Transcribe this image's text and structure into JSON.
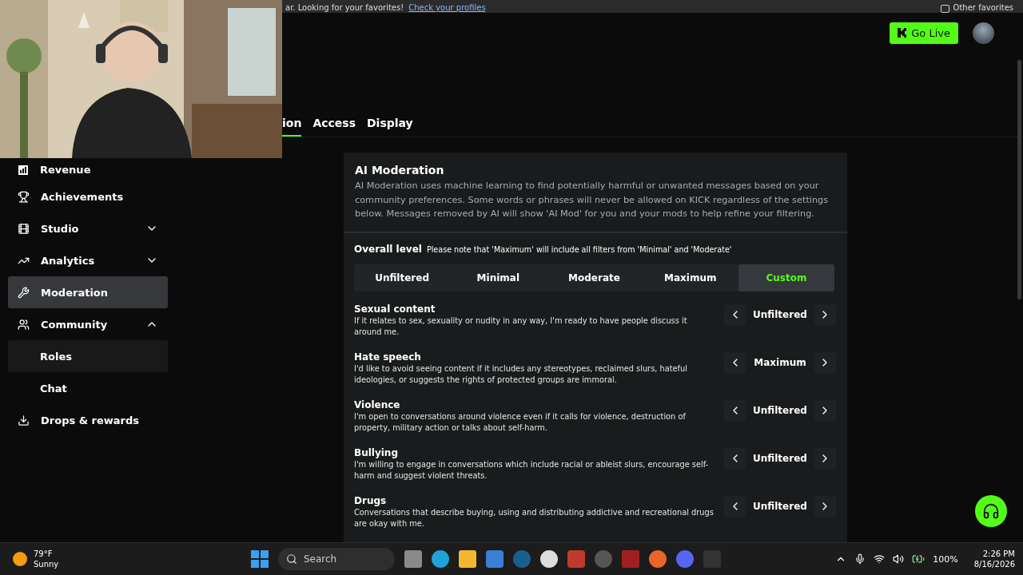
{
  "browser_bar": {
    "message": "ar. Looking for your favorites!",
    "link": "Check your profiles",
    "favorites": "Other favorites"
  },
  "header": {
    "go_live": "Go Live"
  },
  "tabs": [
    {
      "label": "ion",
      "selected": true
    },
    {
      "label": "Access",
      "selected": false
    },
    {
      "label": "Display",
      "selected": false
    }
  ],
  "sidebar": {
    "items": [
      {
        "label": "Revenue",
        "selected": false,
        "hovered": false
      },
      {
        "label": "Achievements",
        "selected": false,
        "hovered": false
      },
      {
        "label": "Studio",
        "selected": false,
        "hovered": false,
        "expanded": false
      },
      {
        "label": "Analytics",
        "selected": false,
        "hovered": false,
        "expanded": false
      },
      {
        "label": "Moderation",
        "selected": true,
        "hovered": false
      },
      {
        "label": "Community",
        "selected": false,
        "hovered": false,
        "expanded": true,
        "children": [
          {
            "label": "Roles",
            "selected": false,
            "hovered": true
          },
          {
            "label": "Chat",
            "selected": false,
            "hovered": false
          }
        ]
      },
      {
        "label": "Drops & rewards",
        "selected": false,
        "hovered": false
      }
    ]
  },
  "card": {
    "title": "AI Moderation",
    "description": "AI Moderation uses machine learning to find potentially harmful or unwanted messages based on your community preferences. Some words or phrases will never be allowed on KICK regardless of the settings below. Messages removed by AI will show 'AI Mod' for you and your mods to help refine your filtering.",
    "overall_label": "Overall level",
    "overall_note": "Please note that 'Maximum' will include all filters from 'Minimal' and 'Moderate'",
    "levels": [
      {
        "label": "Unfiltered",
        "selected": false
      },
      {
        "label": "Minimal",
        "selected": false
      },
      {
        "label": "Moderate",
        "selected": false
      },
      {
        "label": "Maximum",
        "selected": false
      },
      {
        "label": "Custom",
        "selected": true
      }
    ],
    "categories": [
      {
        "title": "Sexual content",
        "description": "If it relates to sex, sexuality or nudity in any way, I'm ready to have people discuss it around me.",
        "value": "Unfiltered"
      },
      {
        "title": "Hate speech",
        "description": "I'd like to avoid seeing content if it includes any stereotypes, reclaimed slurs, hateful ideologies, or suggests the rights of protected groups are immoral.",
        "value": "Maximum"
      },
      {
        "title": "Violence",
        "description": "I'm open to conversations around violence even if it calls for violence, destruction of property, military action or talks about self-harm.",
        "value": "Unfiltered"
      },
      {
        "title": "Bullying",
        "description": "I'm willing to engage in conversations which include racial or ableist slurs, encourage self-harm and suggest violent threats.",
        "value": "Unfiltered"
      },
      {
        "title": "Drugs",
        "description": "Conversations that describe buying, using and distributing addictive and recreational drugs are okay with me.",
        "value": "Unfiltered"
      }
    ]
  },
  "taskbar": {
    "temperature": "79°F",
    "condition": "Sunny",
    "search_placeholder": "Search",
    "battery": "100%",
    "time": "2:26 PM",
    "date": "8/16/2026"
  }
}
